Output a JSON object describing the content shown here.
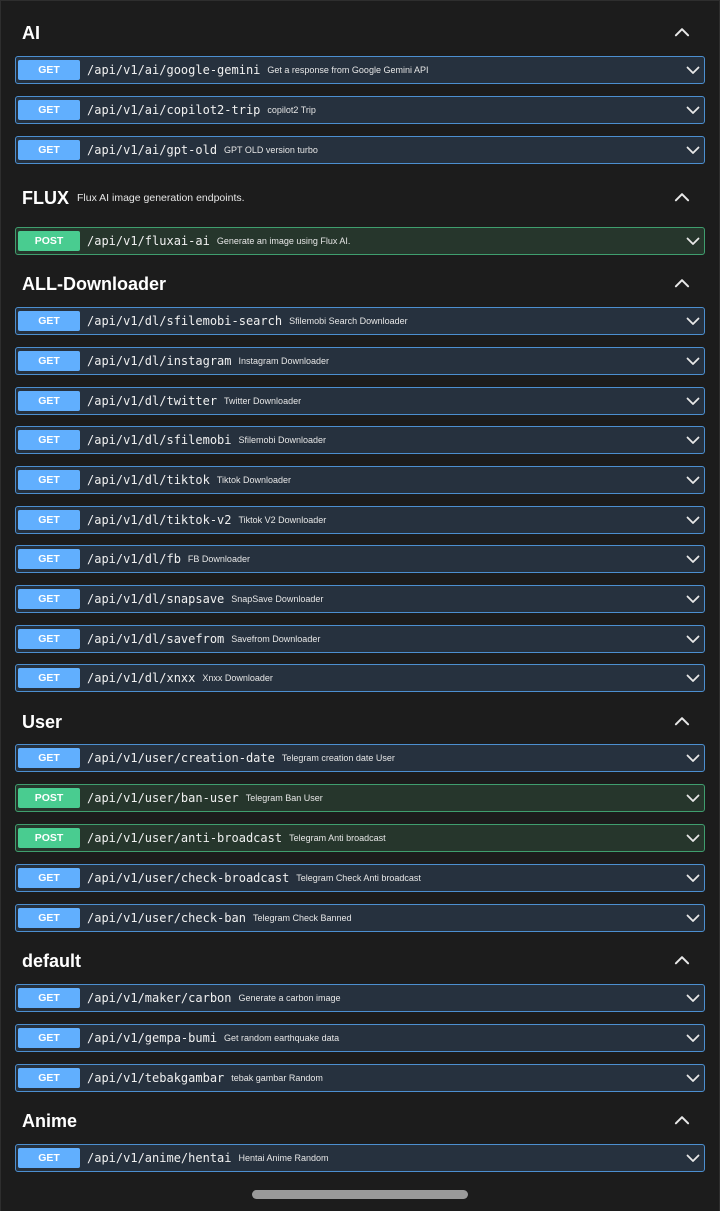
{
  "sections": [
    {
      "title": "AI",
      "description": "",
      "operations": [
        {
          "method": "GET",
          "path": "/api/v1/ai/google-gemini",
          "summary": "Get a response from Google Gemini API"
        },
        {
          "method": "GET",
          "path": "/api/v1/ai/copilot2-trip",
          "summary": "copilot2 Trip"
        },
        {
          "method": "GET",
          "path": "/api/v1/ai/gpt-old",
          "summary": "GPT OLD version turbo"
        }
      ]
    },
    {
      "title": "FLUX",
      "description": "Flux AI image generation endpoints.",
      "operations": [
        {
          "method": "POST",
          "path": "/api/v1/fluxai-ai",
          "summary": "Generate an image using Flux AI."
        }
      ]
    },
    {
      "title": "ALL-Downloader",
      "description": "",
      "operations": [
        {
          "method": "GET",
          "path": "/api/v1/dl/sfilemobi-search",
          "summary": "Sfilemobi Search Downloader"
        },
        {
          "method": "GET",
          "path": "/api/v1/dl/instagram",
          "summary": "Instagram Downloader"
        },
        {
          "method": "GET",
          "path": "/api/v1/dl/twitter",
          "summary": "Twitter Downloader"
        },
        {
          "method": "GET",
          "path": "/api/v1/dl/sfilemobi",
          "summary": "Sfilemobi Downloader"
        },
        {
          "method": "GET",
          "path": "/api/v1/dl/tiktok",
          "summary": "Tiktok Downloader"
        },
        {
          "method": "GET",
          "path": "/api/v1/dl/tiktok-v2",
          "summary": "Tiktok V2 Downloader"
        },
        {
          "method": "GET",
          "path": "/api/v1/dl/fb",
          "summary": "FB Downloader"
        },
        {
          "method": "GET",
          "path": "/api/v1/dl/snapsave",
          "summary": "SnapSave Downloader"
        },
        {
          "method": "GET",
          "path": "/api/v1/dl/savefrom",
          "summary": "Savefrom Downloader"
        },
        {
          "method": "GET",
          "path": "/api/v1/dl/xnxx",
          "summary": "Xnxx Downloader"
        }
      ]
    },
    {
      "title": "User",
      "description": "",
      "operations": [
        {
          "method": "GET",
          "path": "/api/v1/user/creation-date",
          "summary": "Telegram creation date User"
        },
        {
          "method": "POST",
          "path": "/api/v1/user/ban-user",
          "summary": "Telegram Ban User"
        },
        {
          "method": "POST",
          "path": "/api/v1/user/anti-broadcast",
          "summary": "Telegram Anti broadcast"
        },
        {
          "method": "GET",
          "path": "/api/v1/user/check-broadcast",
          "summary": "Telegram Check Anti broadcast"
        },
        {
          "method": "GET",
          "path": "/api/v1/user/check-ban",
          "summary": "Telegram Check Banned"
        }
      ]
    },
    {
      "title": "default",
      "description": "",
      "operations": [
        {
          "method": "GET",
          "path": "/api/v1/maker/carbon",
          "summary": "Generate a carbon image"
        },
        {
          "method": "GET",
          "path": "/api/v1/gempa-bumi",
          "summary": "Get random earthquake data"
        },
        {
          "method": "GET",
          "path": "/api/v1/tebakgambar",
          "summary": "tebak gambar Random"
        }
      ]
    },
    {
      "title": "Anime",
      "description": "",
      "operations": [
        {
          "method": "GET",
          "path": "/api/v1/anime/hentai",
          "summary": "Hentai Anime Random"
        }
      ]
    }
  ],
  "icons": {
    "section_toggle": "chevron-up-icon",
    "operation_expand": "chevron-down-icon"
  },
  "colors": {
    "get_badge": "#61affe",
    "post_badge": "#49cc90",
    "get_border": "#4c8fd0",
    "post_border": "#3f9e6e",
    "background": "#1c1c1c"
  }
}
